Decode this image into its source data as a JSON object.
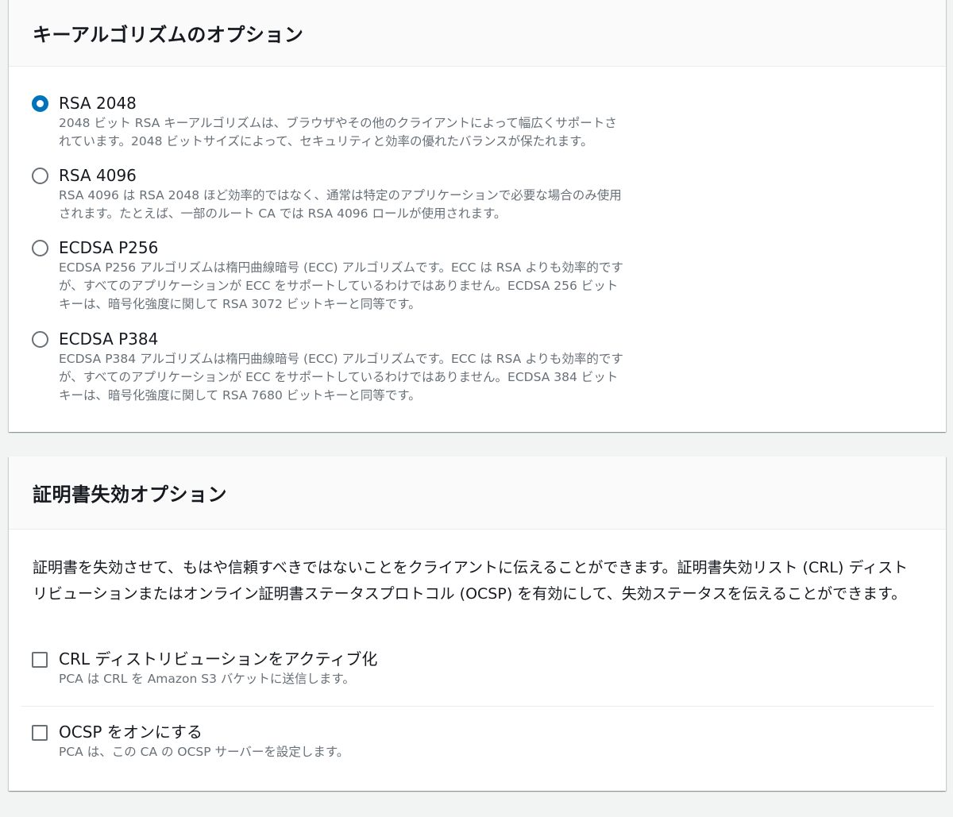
{
  "key_algorithm": {
    "title": "キーアルゴリズムのオプション",
    "selected": "rsa2048",
    "options": [
      {
        "id": "rsa2048",
        "label": "RSA 2048",
        "desc": "2048 ビット RSA キーアルゴリズムは、ブラウザやその他のクライアントによって幅広くサポートさ\nれています。2048 ビットサイズによって、セキュリティと効率の優れたバランスが保たれます。"
      },
      {
        "id": "rsa4096",
        "label": "RSA 4096",
        "desc": "RSA 4096 は RSA 2048 ほど効率的ではなく、通常は特定のアプリケーションで必要な場合のみ使用\nされます。たとえば、一部のルート CA では RSA 4096 ロールが使用されます。"
      },
      {
        "id": "ecdsa256",
        "label": "ECDSA P256",
        "desc": "ECDSA P256 アルゴリズムは楕円曲線暗号 (ECC) アルゴリズムです。ECC は RSA よりも効率的です\nが、すべてのアプリケーションが ECC をサポートしているわけではありません。ECDSA 256 ビット\nキーは、暗号化強度に関して RSA 3072 ビットキーと同等です。"
      },
      {
        "id": "ecdsa384",
        "label": "ECDSA P384",
        "desc": "ECDSA P384 アルゴリズムは楕円曲線暗号 (ECC) アルゴリズムです。ECC は RSA よりも効率的です\nが、すべてのアプリケーションが ECC をサポートしているわけではありません。ECDSA 384 ビット\nキーは、暗号化強度に関して RSA 7680 ビットキーと同等です。"
      }
    ]
  },
  "revocation": {
    "title": "証明書失効オプション",
    "description": "証明書を失効させて、もはや信頼すべきではないことをクライアントに伝えることができます。証明書失効リスト (CRL) ディストリビューションまたはオンライン証明書ステータスプロトコル (OCSP) を有効にして、失効ステータスを伝えることができます。",
    "options": [
      {
        "id": "crl",
        "label": "CRL ディストリビューションをアクティブ化",
        "desc": "PCA は CRL を Amazon S3 バケットに送信します。",
        "checked": false
      },
      {
        "id": "ocsp",
        "label": "OCSP をオンにする",
        "desc": "PCA は、この CA の OCSP サーバーを設定します。",
        "checked": false
      }
    ]
  },
  "colors": {
    "accent": "#0073bb",
    "text": "#16191f",
    "muted": "#687078"
  }
}
